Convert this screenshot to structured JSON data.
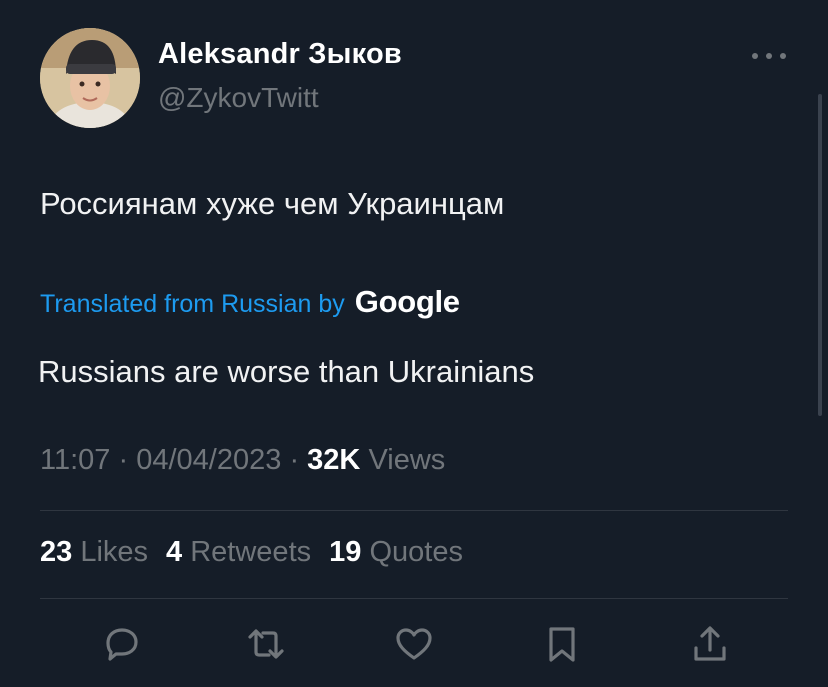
{
  "author": {
    "name": "Aleksandr Зыков",
    "handle": "@ZykovTwitt"
  },
  "tweet": {
    "text": "Россиянам хуже чем Украинцам",
    "translation_label": "Translated from Russian by",
    "translation_provider": "Google",
    "translation": "Russians are worse than Ukrainians"
  },
  "meta": {
    "time": "11:07",
    "date": "04/04/2023",
    "separator": "·",
    "views_count": "32K",
    "views_label": "Views"
  },
  "stats": {
    "likes_count": "23",
    "likes_label": "Likes",
    "retweets_count": "4",
    "retweets_label": "Retweets",
    "quotes_count": "19",
    "quotes_label": "Quotes"
  },
  "icons": {
    "more": "more-icon",
    "reply": "reply-icon",
    "retweet": "retweet-icon",
    "like": "heart-icon",
    "bookmark": "bookmark-icon",
    "share": "share-icon"
  },
  "colors": {
    "background": "#151d28",
    "link": "#1d9bf0",
    "muted": "#71767b",
    "text": "#e7e9ea"
  }
}
